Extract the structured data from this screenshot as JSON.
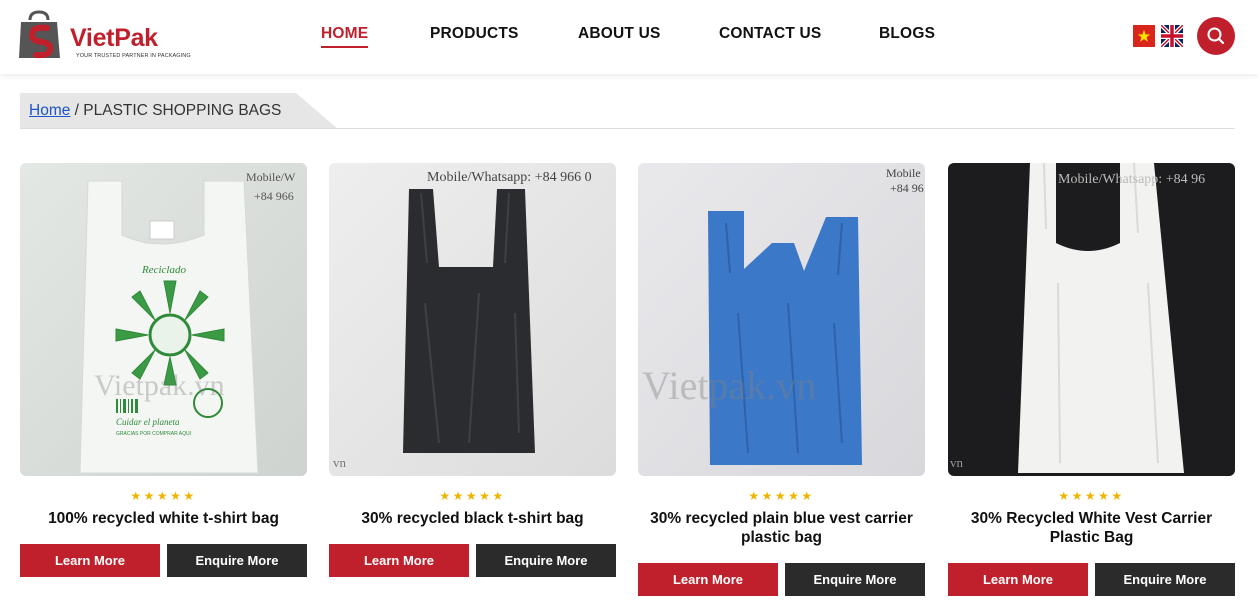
{
  "brand": {
    "name": "VietPak",
    "tagline": "YOUR TRUSTED PARTNER IN PACKAGING",
    "primary_color": "#c0202b"
  },
  "nav": {
    "items": [
      {
        "label": "HOME",
        "active": true
      },
      {
        "label": "PRODUCTS",
        "active": false
      },
      {
        "label": "ABOUT US",
        "active": false
      },
      {
        "label": "CONTACT US",
        "active": false
      },
      {
        "label": "BLOGS",
        "active": false
      }
    ],
    "languages": [
      "vietnam-flag-icon",
      "uk-flag-icon"
    ],
    "search_icon": "search-icon"
  },
  "breadcrumb": {
    "home": "Home",
    "separator": " / ",
    "current": "PLASTIC SHOPPING BAGS"
  },
  "products": [
    {
      "title": "100% recycled white t-shirt bag",
      "stars": "★★★★★",
      "learn_more": "Learn More",
      "enquire_more": "Enquire More",
      "watermark": "Vietpak.vn",
      "overlay": "Mobile/W\n+84 966",
      "bag_texts": [
        "Reciclado",
        "Cuidar el planeta",
        "GRACIAS POR COMPRAR AQUI"
      ]
    },
    {
      "title": "30% recycled black t-shirt bag",
      "stars": "★★★★★",
      "learn_more": "Learn More",
      "enquire_more": "Enquire More",
      "watermark": "vn",
      "overlay": "Mobile/Whatsapp: +84 966 0"
    },
    {
      "title": "30% recycled plain blue vest carrier plastic bag",
      "stars": "★★★★★",
      "learn_more": "Learn More",
      "enquire_more": "Enquire More",
      "watermark": "Vietpak.vn",
      "overlay": "Mobile\n+84 96"
    },
    {
      "title": "30% Recycled White Vest Carrier Plastic Bag",
      "stars": "★★★★★",
      "learn_more": "Learn More",
      "enquire_more": "Enquire More",
      "watermark": "vn",
      "overlay": "Mobile/Whatsapp: +84 96"
    }
  ]
}
